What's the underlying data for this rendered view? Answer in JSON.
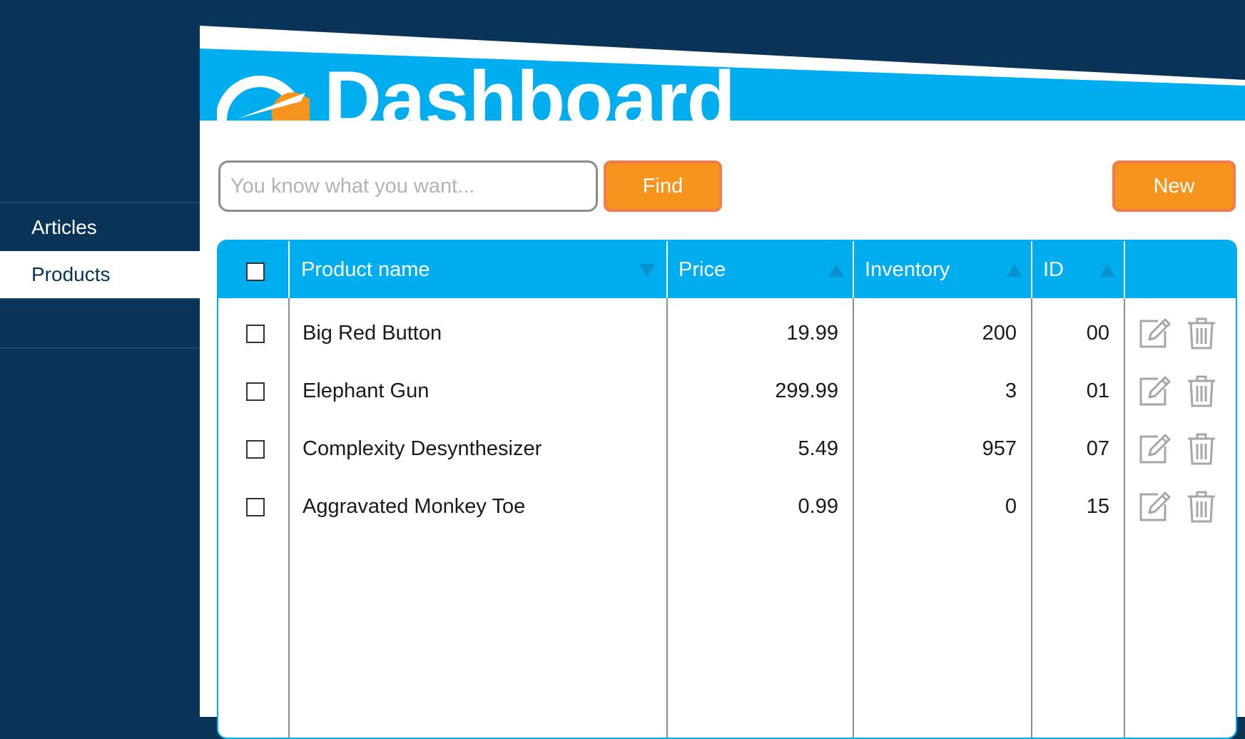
{
  "app": {
    "title": "Dashboard"
  },
  "sidebar": {
    "items": [
      {
        "label": "Articles",
        "active": false
      },
      {
        "label": "Products",
        "active": true
      }
    ]
  },
  "toolbar": {
    "search_placeholder": "You know what you want...",
    "search_value": "",
    "find_label": "Find",
    "new_label": "New"
  },
  "table": {
    "columns": [
      {
        "label": "Product name",
        "sort": "descending"
      },
      {
        "label": "Price",
        "sort": "ascending"
      },
      {
        "label": "Inventory",
        "sort": "ascending"
      },
      {
        "label": "ID",
        "sort": "ascending"
      }
    ],
    "rows": [
      {
        "name": "Big Red Button",
        "price": "19.99",
        "inventory": "200",
        "id": "00",
        "checked": false
      },
      {
        "name": "Elephant Gun",
        "price": "299.99",
        "inventory": "3",
        "id": "01",
        "checked": false
      },
      {
        "name": "Complexity Desynthesizer",
        "price": "5.49",
        "inventory": "957",
        "id": "07",
        "checked": false
      },
      {
        "name": "Aggravated Monkey Toe",
        "price": "0.99",
        "inventory": "0",
        "id": "15",
        "checked": false
      }
    ],
    "row_actions": [
      "edit-icon",
      "trash-icon"
    ]
  },
  "colors": {
    "sidebar_bg": "#0a3358",
    "header_blue": "#00aeef",
    "button_orange": "#f7941d",
    "button_border": "#f47c4c",
    "logo_accent": "#f7941d",
    "icon_gray": "#a6a6a6"
  }
}
